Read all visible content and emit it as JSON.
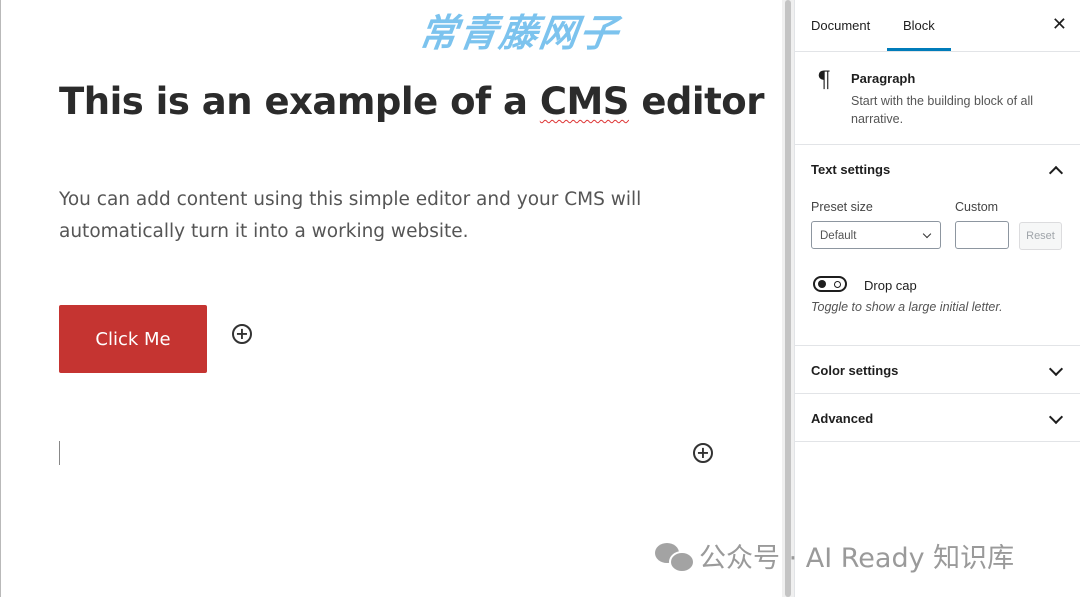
{
  "watermark_top": "常青藤网子",
  "editor": {
    "title_prefix": "This is an example of a ",
    "title_word": "CMS",
    "title_suffix": " editor",
    "paragraph": "You can add content using this simple editor and your CMS will automatically turn it into a working website.",
    "button_label": "Click Me"
  },
  "sidebar": {
    "tabs": [
      "Document",
      "Block"
    ],
    "active_tab": "Block",
    "close_icon": "close-icon",
    "block": {
      "icon": "pilcrow-icon",
      "name": "Paragraph",
      "description": "Start with the building block of all narrative."
    },
    "text_settings": {
      "title": "Text settings",
      "preset_label": "Preset size",
      "preset_value": "Default",
      "custom_label": "Custom",
      "custom_value": "",
      "reset_label": "Reset",
      "drop_cap_label": "Drop cap",
      "drop_cap_help": "Toggle to show a large initial letter.",
      "drop_cap_enabled": false
    },
    "color_settings_title": "Color settings",
    "advanced_title": "Advanced"
  },
  "watermark_bottom": "公众号 · AI Ready 知识库",
  "colors": {
    "button_bg": "#c53431",
    "tab_accent": "#007cba"
  }
}
